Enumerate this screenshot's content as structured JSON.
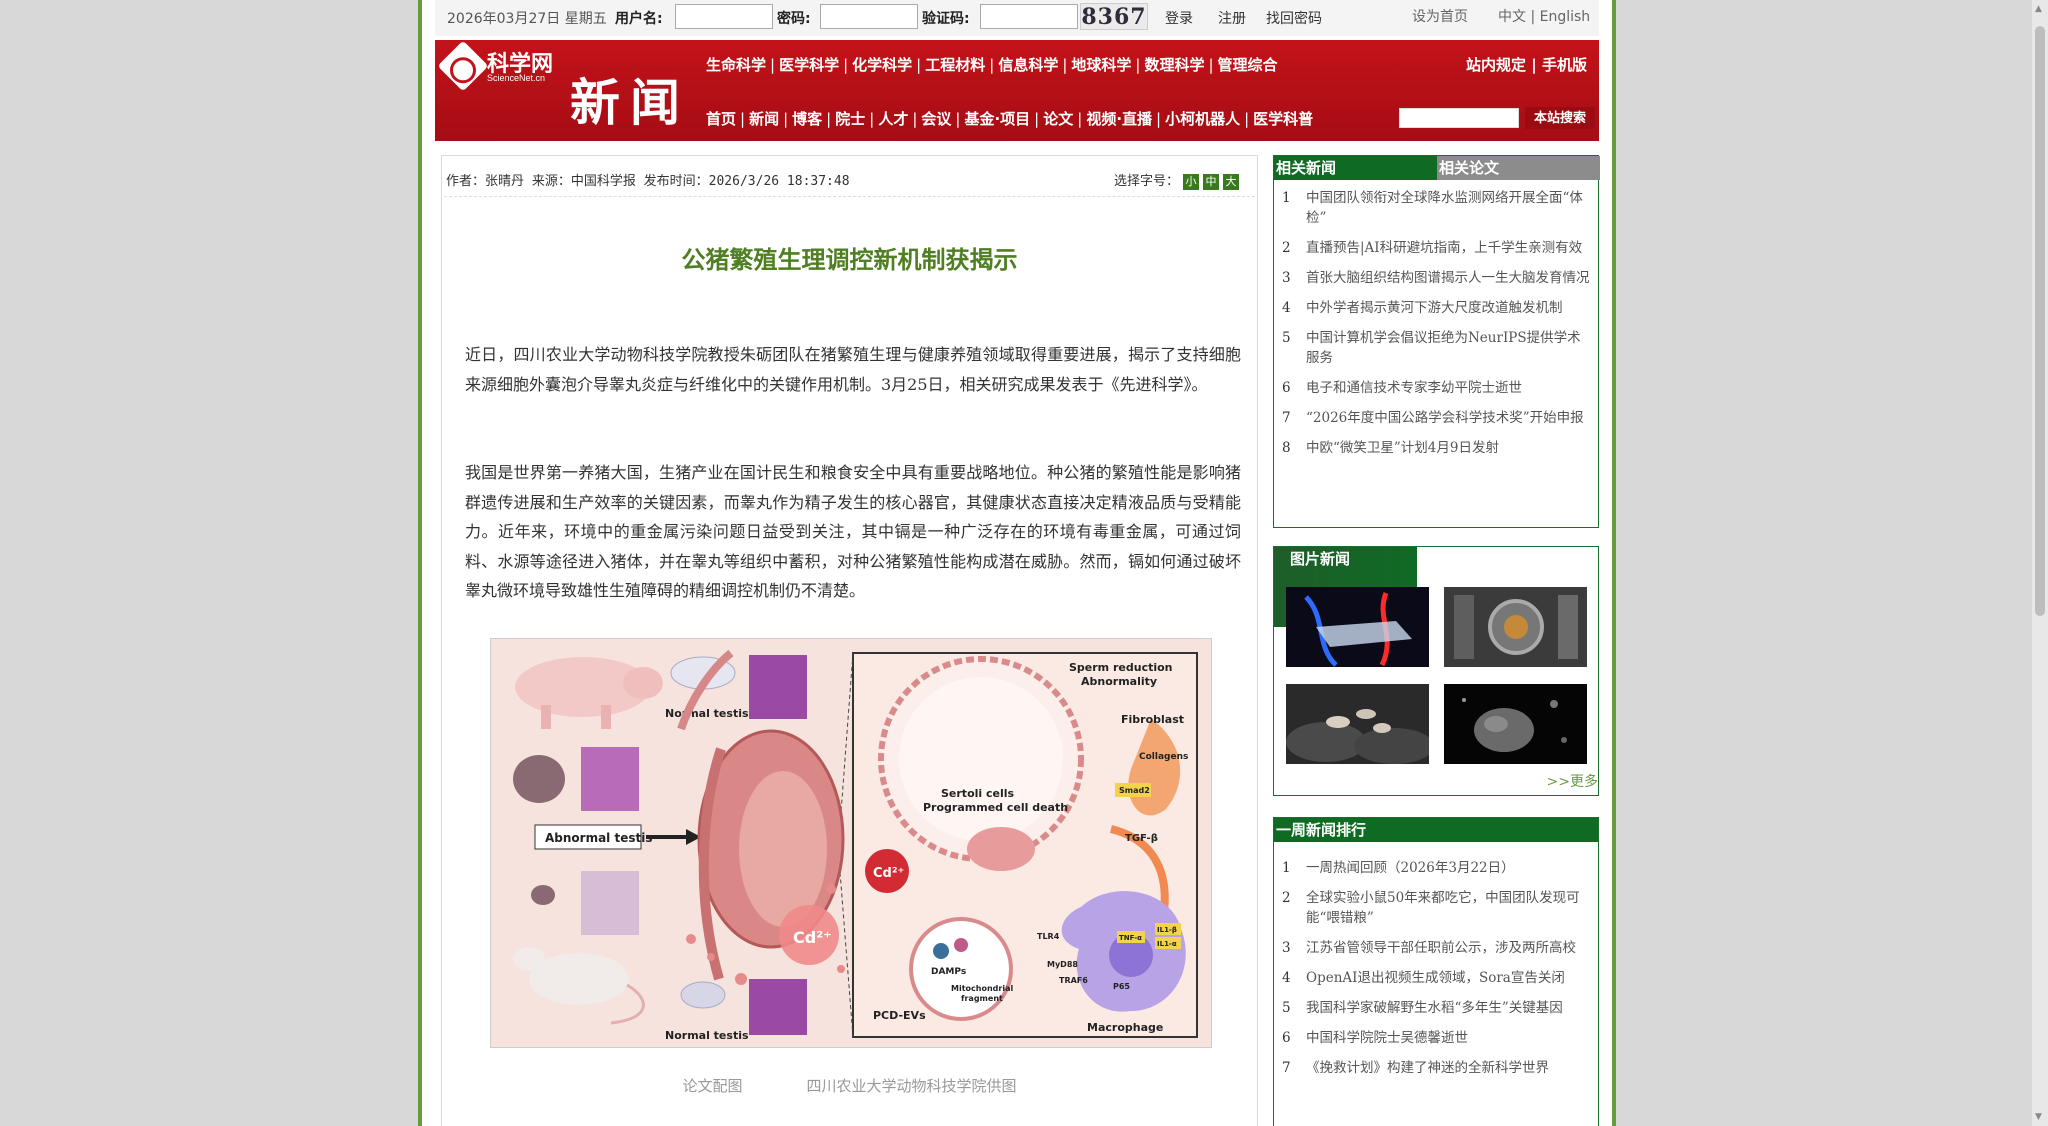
{
  "topbar": {
    "date": "2026年03月27日 星期五",
    "username_label": "用户名:",
    "password_label": "密码:",
    "captcha_label": "验证码:",
    "captcha_value": "8367",
    "login": "登录",
    "register": "注册",
    "find_password": "找回密码",
    "set_homepage": "设为首页",
    "lang_cn": "中文",
    "lang_sep": "|",
    "lang_en": "English"
  },
  "header": {
    "logo_text": "科学网",
    "logo_sub": "ScienceNet.cn",
    "section_title": "新闻",
    "nav_top": [
      "生命科学",
      "医学科学",
      "化学科学",
      "工程材料",
      "信息科学",
      "地球科学",
      "数理科学",
      "管理综合"
    ],
    "nav_bottom": [
      "首页",
      "新闻",
      "博客",
      "院士",
      "人才",
      "会议",
      "基金·项目",
      "论文",
      "视频·直播",
      "小柯机器人",
      "医学科普"
    ],
    "nav_right": [
      "站内规定",
      "手机版"
    ],
    "search_button": "本站搜索"
  },
  "article": {
    "meta": "作者：张晴丹 来源：中国科学报 发布时间：2026/3/26 18:37:48",
    "font_size_label": "选择字号：",
    "font_sizes": [
      "小",
      "中",
      "大"
    ],
    "title": "公猪繁殖生理调控新机制获揭示",
    "paragraph1": "近日，四川农业大学动物科技学院教授朱砺团队在猪繁殖生理与健康养殖领域取得重要进展，揭示了支持细胞来源细胞外囊泡介导睾丸炎症与纤维化中的关键作用机制。3月25日，相关研究成果发表于《先进科学》。",
    "paragraph2": "我国是世界第一养猪大国，生猪产业在国计民生和粮食安全中具有重要战略地位。种公猪的繁殖性能是影响猪群遗传进展和生产效率的关键因素，而睾丸作为精子发生的核心器官，其健康状态直接决定精液品质与受精能力。近年来，环境中的重金属污染问题日益受到关注，其中镉是一种广泛存在的环境有毒重金属，可通过饲料、水源等途径进入猪体，并在睾丸等组织中蓄积，对种公猪繁殖性能构成潜在威胁。然而，镉如何通过破坏睾丸微环境导致雄性生殖障碍的精细调控机制仍不清楚。",
    "figure_labels": {
      "normal_testis_top": "Normal testis",
      "abnormal_testis": "Abnormal testis",
      "normal_testis_bottom": "Normal testis",
      "sperm": "Sperm reduction",
      "abnormality": "Abnormality",
      "fibroblast": "Fibroblast",
      "collagens": "Collagens",
      "smad2": "Smad2",
      "sertoli": "Sertoli cells",
      "pcd": "Programmed cell death",
      "tgf": "TGF-β",
      "cd": "Cd²⁺",
      "damps": "DAMPs",
      "mito": "Mitochondrial",
      "fragment": "fragment",
      "tlr4": "TLR4",
      "myd88": "MyD88",
      "traf6": "TRAF6",
      "tnf": "TNF-α",
      "il1b": "IL1-β",
      "il1a": "IL1-α",
      "p65": "P65",
      "macrophage": "Macrophage",
      "pcd_evs": "PCD-EVs"
    },
    "caption_left": "论文配图",
    "caption_right": "四川农业大学动物科技学院供图"
  },
  "sidebar": {
    "tab_related_news": "相关新闻",
    "tab_related_papers": "相关论文",
    "related_news": [
      "中国团队领衔对全球降水监测网络开展全面“体检”",
      "直播预告|AI科研避坑指南，上千学生亲测有效",
      "首张大脑组织结构图谱揭示人一生大脑发育情况",
      "中外学者揭示黄河下游大尺度改道触发机制",
      "中国计算机学会倡议拒绝为NeurIPS提供学术服务",
      "电子和通信技术专家李幼平院士逝世",
      "“2026年度中国公路学会科学技术奖”开始申报",
      "中欧“微笑卫星”计划4月9日发射"
    ],
    "picture_news_title": "图片新闻",
    "more": ">>更多",
    "weekly_title": "一周新闻排行",
    "weekly_news": [
      "一周热闻回顾（2026年3月22日）",
      "全球实验小鼠50年来都吃它，中国团队发现可能“喂错粮”",
      "江苏省管领导干部任职前公示，涉及两所高校",
      "OpenAI退出视频生成领域，Sora宣告关闭",
      "我国科学家破解野生水稻“多年生”关键基因",
      "中国科学院院士吴德馨逝世",
      "《挽救计划》构建了神迷的全新科学世界"
    ]
  }
}
